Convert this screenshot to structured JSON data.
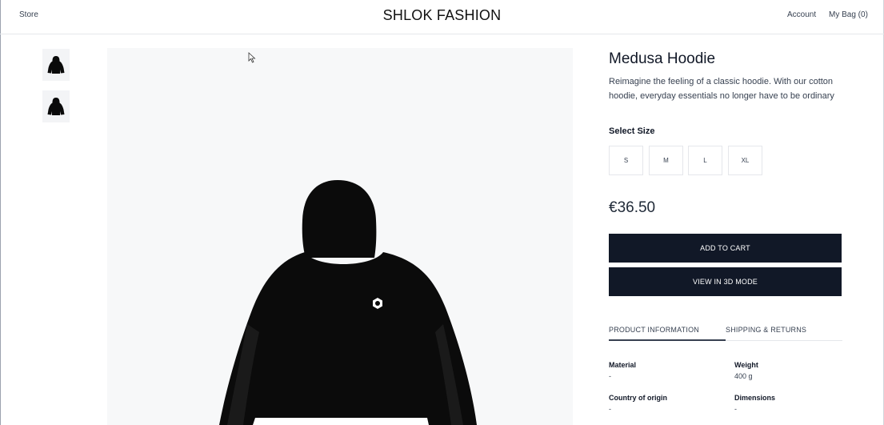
{
  "header": {
    "store_label": "Store",
    "brand": "SHLOK FASHION",
    "account_label": "Account",
    "bag_label": "My Bag (0)"
  },
  "gallery": {
    "thumbnails": [
      "hoodie-icon",
      "hoodie-icon"
    ],
    "main_image": "black-hoodie"
  },
  "product": {
    "title": "Medusa Hoodie",
    "description": "Reimagine the feeling of a classic hoodie. With our cotton hoodie, everyday essentials no longer have to be ordinary",
    "size_label": "Select Size",
    "sizes": [
      "S",
      "M",
      "L",
      "XL"
    ],
    "price": "€36.50",
    "add_to_cart": "ADD TO CART",
    "view_3d": "VIEW IN 3D MODE"
  },
  "tabs": {
    "product_info": "PRODUCT INFORMATION",
    "shipping": "SHIPPING & RETURNS"
  },
  "specs": {
    "material_label": "Material",
    "material_value": "-",
    "weight_label": "Weight",
    "weight_value": "400 g",
    "origin_label": "Country of origin",
    "origin_value": "-",
    "dimensions_label": "Dimensions",
    "dimensions_value": "-"
  },
  "colors": {
    "primary_button": "#111827",
    "image_background": "#f7f8f9"
  }
}
